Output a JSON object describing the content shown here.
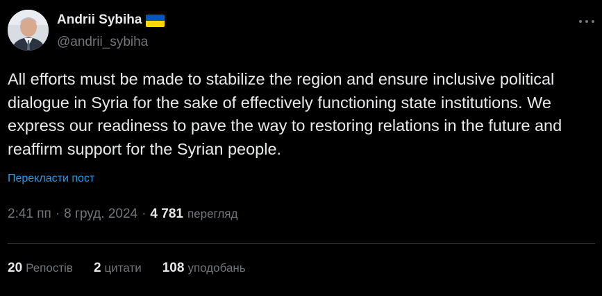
{
  "author": {
    "display_name": "Andrii Sybiha",
    "handle": "@andrii_sybiha",
    "flag_icon": "ukraine-flag-icon",
    "flag_colors": [
      "#0057b7",
      "#ffd700"
    ]
  },
  "tweet": {
    "text": "All efforts must be made to stabilize the region and ensure inclusive political dialogue in Syria for the sake of effectively functioning state institutions. We express our readiness to pave the way to restoring relations in the future and reaffirm support for the Syrian people.",
    "translate_label": "Перекласти пост"
  },
  "meta": {
    "time": "2:41 пп",
    "separator": "·",
    "date": "8 груд. 2024",
    "views_count": "4 781",
    "views_label": "перегляд"
  },
  "stats": {
    "reposts_count": "20",
    "reposts_label": "Репостів",
    "quotes_count": "2",
    "quotes_label": "цитати",
    "likes_count": "108",
    "likes_label": "уподобань"
  },
  "colors": {
    "background": "#000000",
    "text_primary": "#e7e9ea",
    "text_secondary": "#71767b",
    "link": "#1d9bf0",
    "divider": "#2f3336"
  },
  "icons": {
    "more": "more-options-icon"
  }
}
